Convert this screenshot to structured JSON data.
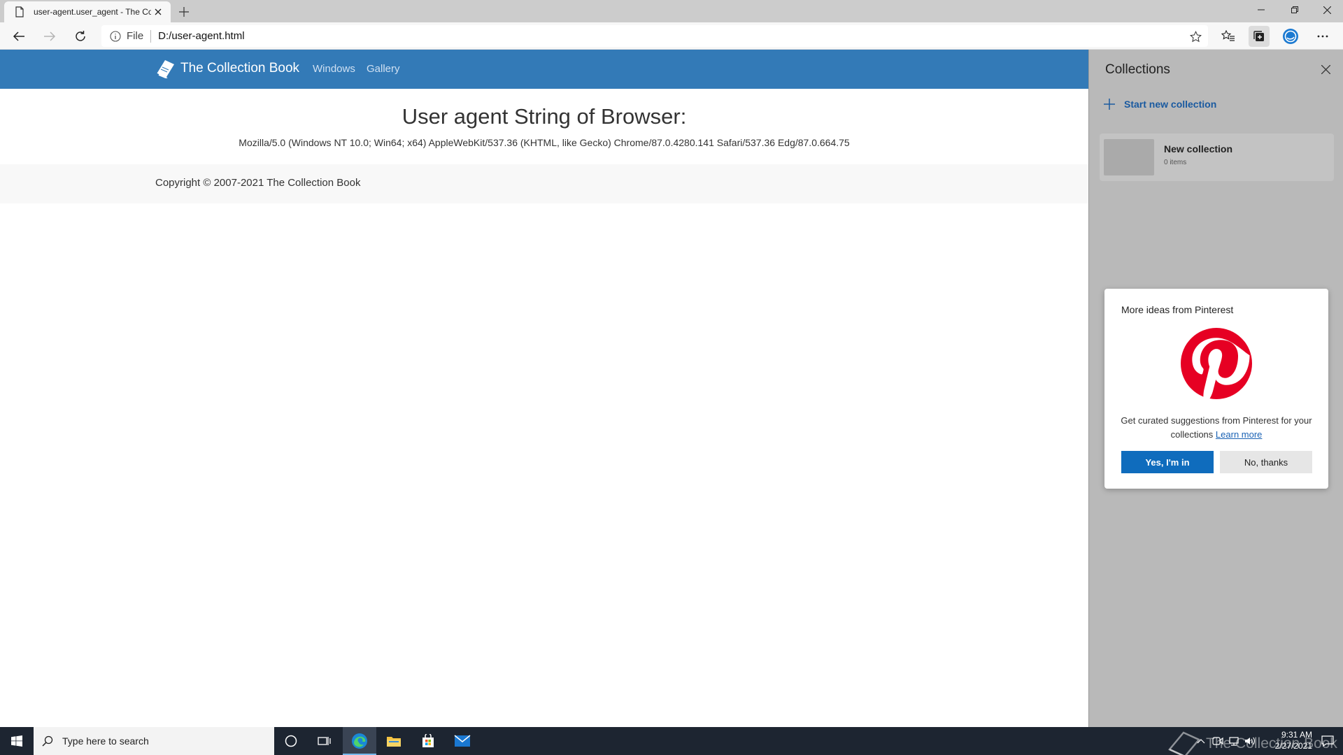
{
  "browser": {
    "tab_title": "user-agent.user_agent - The Coll",
    "address_scheme": "File",
    "address_url": "D:/user-agent.html"
  },
  "site": {
    "brand": "The Collection Book",
    "nav": [
      "Windows",
      "Gallery"
    ],
    "headline": "User agent String of Browser:",
    "user_agent": "Mozilla/5.0 (Windows NT 10.0; Win64; x64) AppleWebKit/537.36 (KHTML, like Gecko) Chrome/87.0.4280.141 Safari/537.36 Edg/87.0.664.75",
    "footer": "Copyright © 2007-2021 The Collection Book",
    "brand_color": "#337ab7"
  },
  "collections": {
    "title": "Collections",
    "start_new": "Start new collection",
    "items": [
      {
        "name": "New collection",
        "count": "0 items"
      }
    ],
    "pinterest": {
      "title": "More ideas from Pinterest",
      "body": "Get curated suggestions from Pinterest for your collections",
      "learn_more": "Learn more",
      "yes": "Yes, I'm in",
      "no": "No, thanks",
      "logo_color": "#e60023"
    }
  },
  "taskbar": {
    "search_placeholder": "Type here to search",
    "time": "9:31 AM",
    "date": "2/27/2021",
    "watermark": "The Collection Book"
  }
}
